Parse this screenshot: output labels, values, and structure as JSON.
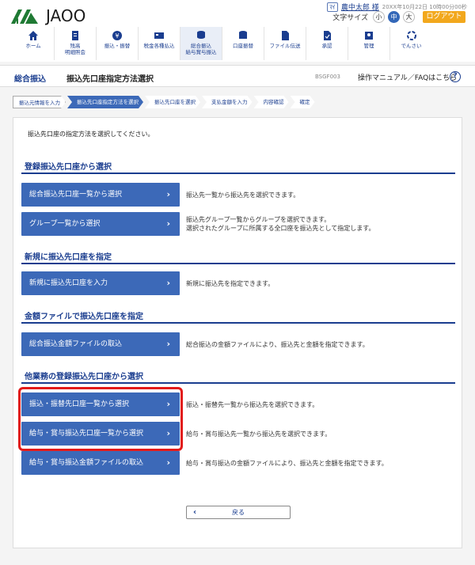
{
  "header": {
    "logo_text": "JAOO",
    "user_icon_label": "ﾏｲ",
    "user_name": "農中太郎 様",
    "timestamp": "20XX年10月22日 10時00分00秒",
    "font_size_label": "文字サイズ",
    "font_sizes": [
      "小",
      "中",
      "大"
    ],
    "active_font_size": "中",
    "logout_label": "ログアウト"
  },
  "nav": {
    "items": [
      {
        "label": "ホーム",
        "icon": "home-icon"
      },
      {
        "label": "残高\n明細照会",
        "icon": "balance-icon"
      },
      {
        "label": "振込・振替",
        "icon": "transfer-icon"
      },
      {
        "label": "税金各種払込",
        "icon": "tax-icon"
      },
      {
        "label": "総合振込\n給与賞与振込",
        "icon": "bulk-transfer-icon"
      },
      {
        "label": "口座振替",
        "icon": "account-transfer-icon"
      },
      {
        "label": "ファイル伝送",
        "icon": "file-transfer-icon"
      },
      {
        "label": "承認",
        "icon": "approval-icon"
      },
      {
        "label": "管理",
        "icon": "admin-icon"
      },
      {
        "label": "でんさい",
        "icon": "densai-icon"
      }
    ],
    "active_index": 4
  },
  "titlebar": {
    "main": "総合振込",
    "sub": "振込先口座指定方法選択",
    "code": "BSGF003",
    "help": "操作マニュアル／FAQはこちら",
    "help_icon": "?"
  },
  "steps": [
    {
      "label": "振込元情報を入力"
    },
    {
      "label": "振込先口座指定方法を選択"
    },
    {
      "label": "振込先口座を選択"
    },
    {
      "label": "支払金額を入力"
    },
    {
      "label": "内容確認"
    },
    {
      "label": "確定"
    }
  ],
  "active_step": 1,
  "main": {
    "intro": "振込先口座の指定方法を選択してください。",
    "sections": [
      {
        "title": "登録振込先口座から選択",
        "buttons": [
          {
            "label": "総合振込先口座一覧から選択",
            "desc": [
              "振込先一覧から振込先を選択できます。"
            ]
          },
          {
            "label": "グループ一覧から選択",
            "desc": [
              "振込先グループ一覧からグループを選択できます。",
              "選択されたグループに所属する全口座を振込先として指定します。"
            ]
          }
        ]
      },
      {
        "title": "新規に振込先口座を指定",
        "buttons": [
          {
            "label": "新規に振込先口座を入力",
            "desc": [
              "新規に振込先を指定できます。"
            ]
          }
        ]
      },
      {
        "title": "金額ファイルで振込先口座を指定",
        "buttons": [
          {
            "label": "総合振込金額ファイルの取込",
            "desc": [
              "総合振込の金額ファイルにより、振込先と金額を指定できます。"
            ]
          }
        ]
      },
      {
        "title": "他業務の登録振込先口座から選択",
        "buttons": [
          {
            "label": "振込・振替先口座一覧から選択",
            "desc": [
              "振込・振替先一覧から振込先を選択できます。"
            ]
          },
          {
            "label": "給与・賞与振込先口座一覧から選択",
            "desc": [
              "給与・賞与振込先一覧から振込先を選択できます。"
            ]
          },
          {
            "label": "給与・賞与振込金額ファイルの取込",
            "desc": [
              "給与・賞与振込の金額ファイルにより、振込先と金額を指定できます。"
            ]
          }
        ]
      }
    ],
    "back_label": "戻る",
    "chevron": "›",
    "back_chevron": "‹"
  },
  "colors": {
    "primary": "#3c69b8",
    "title_blue": "#1a3d8f",
    "logout": "#f2a81d",
    "highlight": "#e21a1a"
  }
}
